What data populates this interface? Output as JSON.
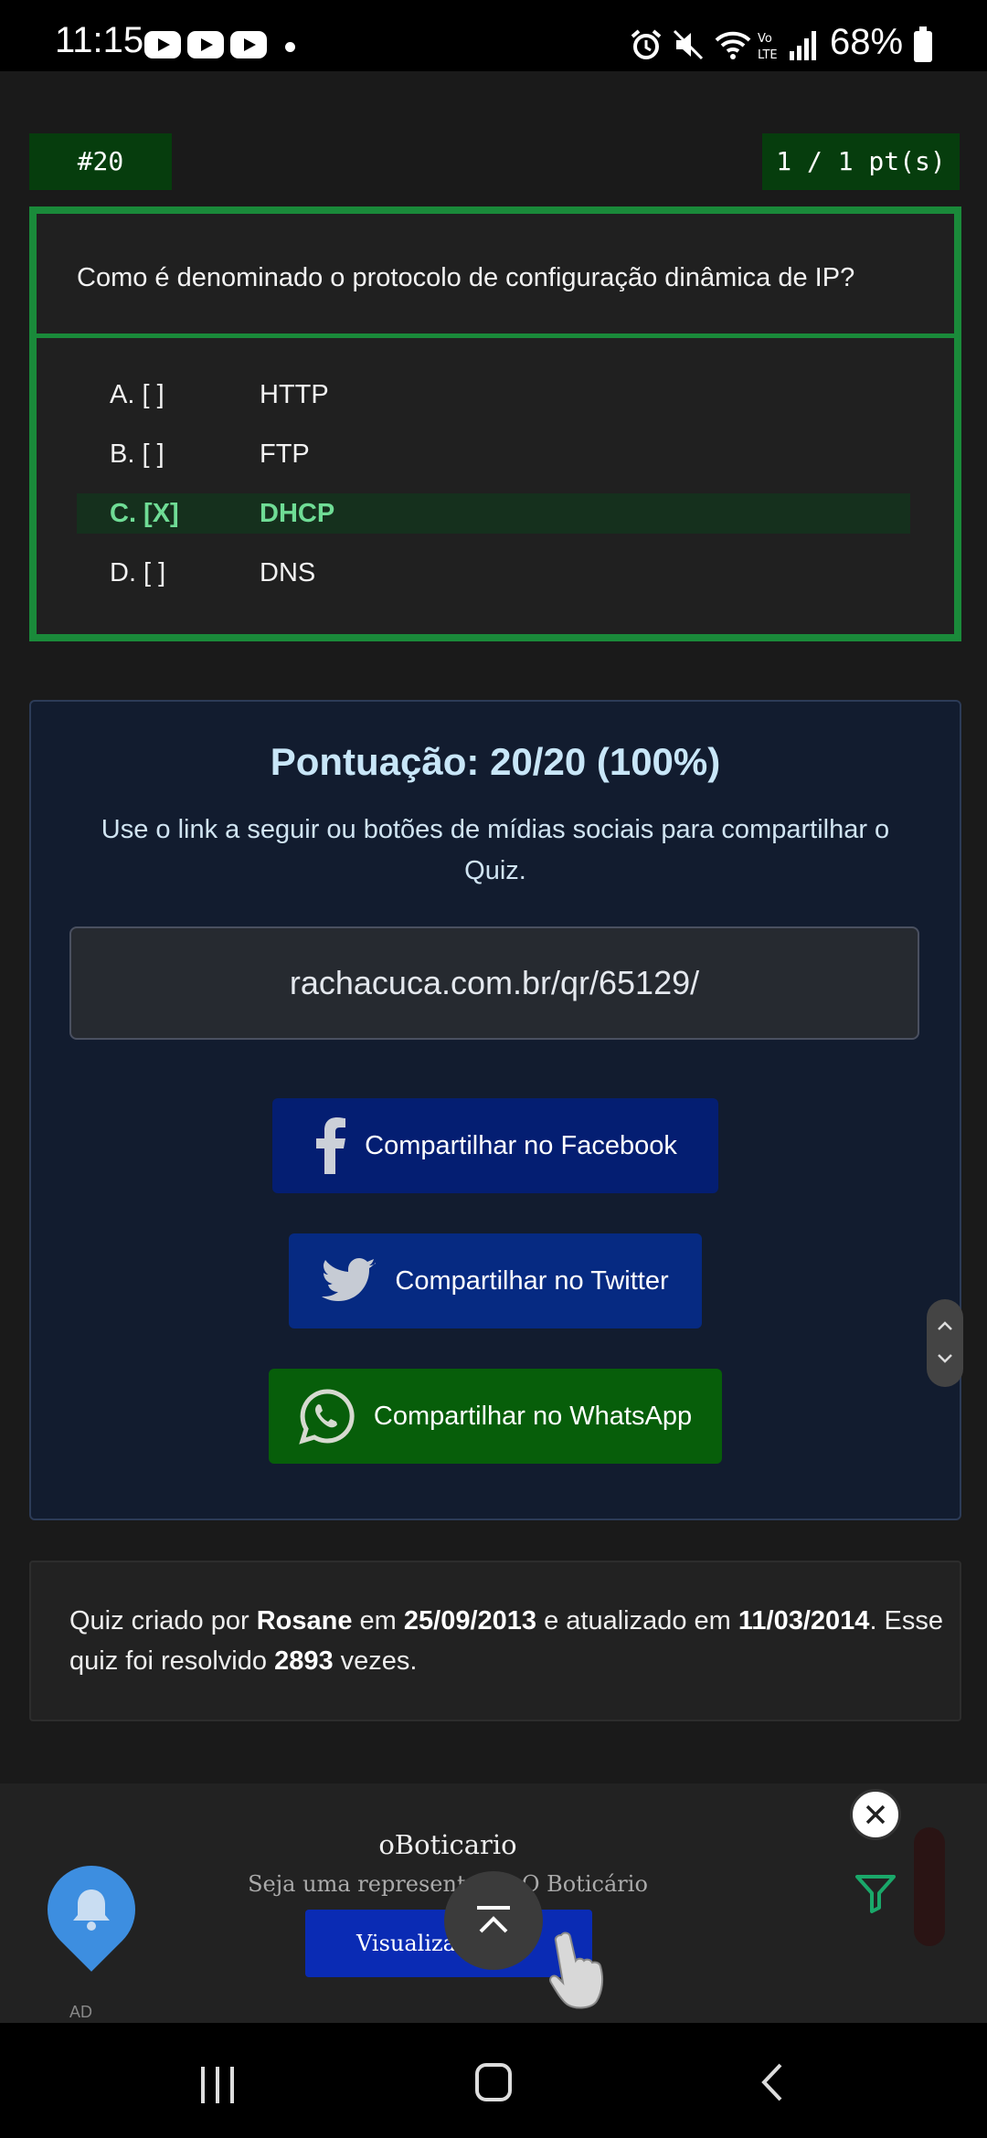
{
  "status_bar": {
    "time": "11:15",
    "battery": "68%",
    "icons": [
      "youtube-icon",
      "youtube-icon",
      "youtube-icon",
      "notification-dot",
      "alarm-icon",
      "mute-icon",
      "wifi-icon",
      "volte-icon",
      "signal-icon",
      "battery-icon"
    ]
  },
  "question": {
    "number": "#20",
    "points": "1 / 1 pt(s)",
    "text": "Como é denominado o protocolo de configuração dinâmica de IP?",
    "options": [
      {
        "letter": "A. [  ]",
        "answer": "HTTP"
      },
      {
        "letter": "B. [  ]",
        "answer": "FTP"
      },
      {
        "letter": "C. [X]",
        "answer": "DHCP"
      },
      {
        "letter": "D. [  ]",
        "answer": "DNS"
      }
    ],
    "colors": {
      "border": "#1a8a3a",
      "selected_text": "#6fdc95"
    }
  },
  "score": {
    "title": "Pontuação: 20/20 (100%)",
    "description": "Use o link a seguir ou botões de mídias sociais para compartilhar o Quiz.",
    "link": "rachacuca.com.br/qr/65129/",
    "buttons": {
      "facebook": "Compartilhar no Facebook",
      "twitter": "Compartilhar no Twitter",
      "whatsapp": "Compartilhar no WhatsApp"
    },
    "colors": {
      "facebook": "#041e72",
      "twitter": "#062a82",
      "whatsapp": "#075e0a"
    }
  },
  "info": {
    "prefix": "Quiz criado por ",
    "author": "Rosane",
    "mid1": " em ",
    "created": "25/09/2013",
    "mid2": " e atualizado em ",
    "updated": "11/03/2014",
    "mid3": ". Esse quiz foi resolvido ",
    "count": "2893",
    "suffix": " vezes."
  },
  "ad": {
    "brand": "oBoticario",
    "subtitle": "Seja uma representante O Boticário",
    "button": "Visualizar",
    "label": "AD"
  }
}
